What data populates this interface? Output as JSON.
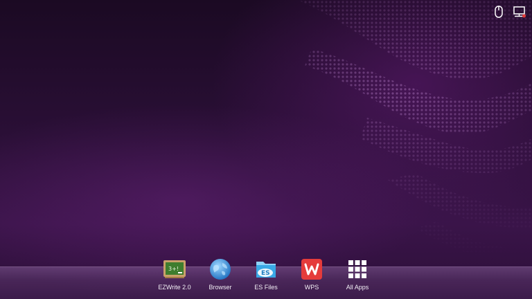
{
  "status_bar": {
    "icons": [
      "mouse-icon",
      "network-disconnected-icon"
    ],
    "alert_color": "#e23b3b"
  },
  "dock": {
    "apps": [
      {
        "label": "EZWrite 2.0",
        "icon": "chalkboard-icon",
        "color": "#3e7d2e"
      },
      {
        "label": "Browser",
        "icon": "globe-icon",
        "color": "#2e8fd8"
      },
      {
        "label": "ES Files",
        "icon": "folder-icon",
        "color": "#39a9e6"
      },
      {
        "label": "WPS",
        "icon": "wps-logo-icon",
        "color": "#e53b3b"
      },
      {
        "label": "All Apps",
        "icon": "app-grid-icon",
        "color": "#ffffff"
      }
    ]
  },
  "colors": {
    "background": "#2a0f36",
    "accent": "#7a2f91"
  }
}
